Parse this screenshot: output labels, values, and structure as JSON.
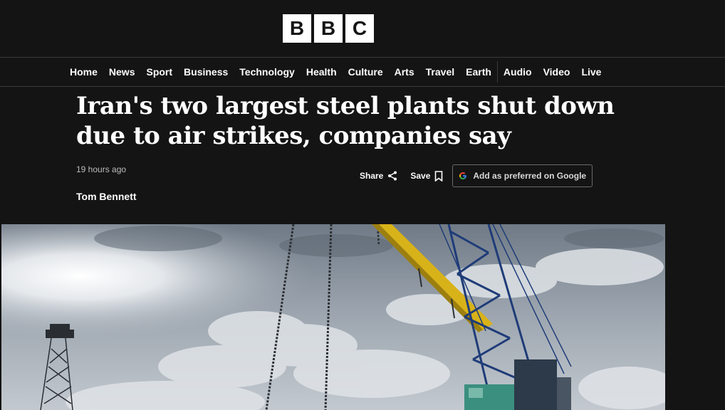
{
  "brand": {
    "letters": [
      "B",
      "B",
      "C"
    ]
  },
  "nav": {
    "items": [
      "Home",
      "News",
      "Sport",
      "Business",
      "Technology",
      "Health",
      "Culture",
      "Arts",
      "Travel",
      "Earth"
    ],
    "secondary": [
      "Audio",
      "Video",
      "Live"
    ]
  },
  "article": {
    "headline": "Iran's two largest steel plants shut down due to air strikes, companies say",
    "timestamp": "19 hours ago",
    "author": "Tom Bennett",
    "share_label": "Share",
    "save_label": "Save",
    "google_label": "Add as preferred on Google"
  },
  "hero_image": {
    "icon": "construction-cranes-photo"
  },
  "colors": {
    "background": "#141414",
    "text": "#ffffff",
    "muted": "#bdbdbd",
    "border": "#3a3a3a"
  }
}
